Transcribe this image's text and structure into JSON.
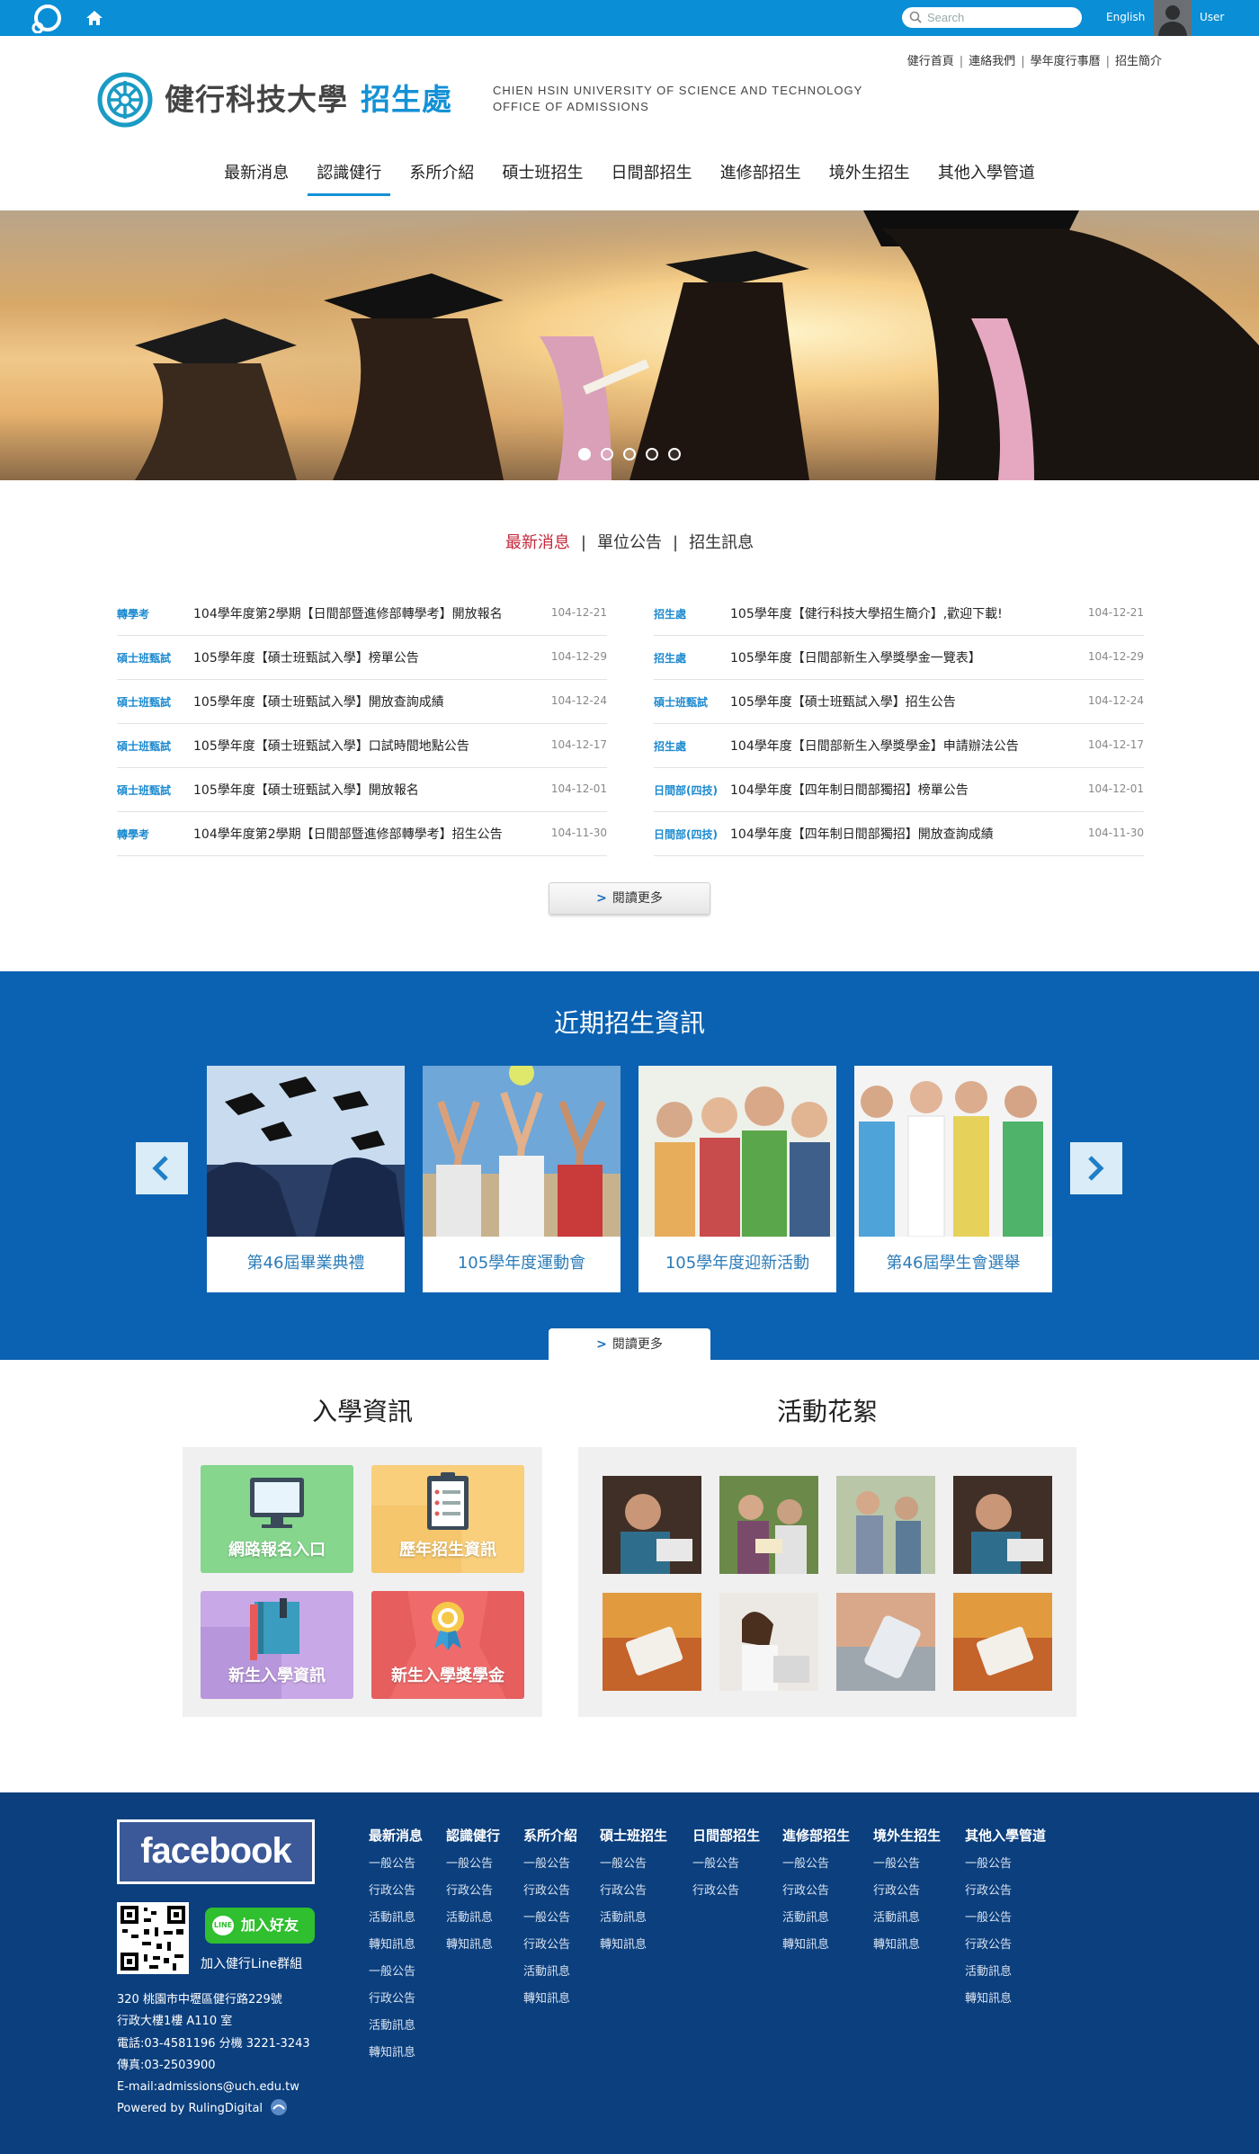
{
  "topbar": {
    "search_placeholder": "Search",
    "language": "English",
    "user": "User"
  },
  "header": {
    "utility_links": [
      "健行首頁",
      "連絡我們",
      "學年度行事曆",
      "招生簡介"
    ],
    "brand_zh": "健行科技大學",
    "brand_dept": "招生處",
    "brand_en_line1": "CHIEN HSIN UNIVERSITY OF SCIENCE AND TECHNOLOGY",
    "brand_en_line2": "OFFICE OF ADMISSIONS",
    "nav": [
      "最新消息",
      "認識健行",
      "系所介紹",
      "碩士班招生",
      "日間部招生",
      "進修部招生",
      "境外生招生",
      "其他入學管道"
    ],
    "nav_active": 1
  },
  "hero": {
    "slides": 5,
    "active_slide": 0
  },
  "news": {
    "tabs": [
      "最新消息",
      "單位公告",
      "招生訊息"
    ],
    "active_tab": 0,
    "left": [
      {
        "cat": "轉學考",
        "title": "104學年度第2學期【日間部暨進修部轉學考】開放報名",
        "date": "104-12-21"
      },
      {
        "cat": "碩士班甄試",
        "title": "105學年度【碩士班甄試入學】榜單公告",
        "date": "104-12-29"
      },
      {
        "cat": "碩士班甄試",
        "title": "105學年度【碩士班甄試入學】開放查詢成績",
        "date": "104-12-24"
      },
      {
        "cat": "碩士班甄試",
        "title": "105學年度【碩士班甄試入學】口試時間地點公告",
        "date": "104-12-17"
      },
      {
        "cat": "碩士班甄試",
        "title": "105學年度【碩士班甄試入學】開放報名",
        "date": "104-12-01"
      },
      {
        "cat": "轉學考",
        "title": "104學年度第2學期【日間部暨進修部轉學考】招生公告",
        "date": "104-11-30"
      }
    ],
    "right": [
      {
        "cat": "招生處",
        "title": "105學年度【健行科技大學招生簡介】,歡迎下載!",
        "date": "104-12-21"
      },
      {
        "cat": "招生處",
        "title": "105學年度【日間部新生入學獎學金一覽表】",
        "date": "104-12-29"
      },
      {
        "cat": "碩士班甄試",
        "title": "105學年度【碩士班甄試入學】招生公告",
        "date": "104-12-24"
      },
      {
        "cat": "招生處",
        "title": "104學年度【日間部新生入學獎學金】申請辦法公告",
        "date": "104-12-17"
      },
      {
        "cat": "日間部(四技)",
        "title": "104學年度【四年制日間部獨招】榜單公告",
        "date": "104-12-01"
      },
      {
        "cat": "日間部(四技)",
        "title": "104學年度【四年制日間部獨招】開放查詢成績",
        "date": "104-11-30"
      }
    ],
    "more_label": "閱讀更多"
  },
  "recent": {
    "title": "近期招生資訊",
    "cards": [
      "第46屆畢業典禮",
      "105學年度運動會",
      "105學年度迎新活動",
      "第46屆學生會選舉"
    ],
    "more_label": "閱讀更多"
  },
  "admission_info": {
    "title": "入學資訊",
    "tiles": [
      {
        "label": "網路報名入口",
        "color": "#86d68e"
      },
      {
        "label": "歷年招生資訊",
        "color": "#f9cf7c"
      },
      {
        "label": "新生入學資訊",
        "color": "#c8a8e6"
      },
      {
        "label": "新生入學獎學金",
        "color": "#ef6b6b"
      }
    ]
  },
  "gallery": {
    "title": "活動花絮"
  },
  "footer": {
    "facebook": "facebook",
    "line_button": "加入好友",
    "line_icon": "LINE",
    "line_caption": "加入健行Line群組",
    "address": [
      "320 桃園市中壢區健行路229號",
      "行政大樓1樓 A110 室",
      "電話:03-4581196 分機 3221-3243",
      "傳真:03-2503900",
      "E-mail:admissions@uch.edu.tw",
      "Powered by RulingDigital"
    ],
    "columns": [
      {
        "heading": "最新消息",
        "links": [
          "一般公告",
          "行政公告",
          "活動訊息",
          "轉知訊息",
          "一般公告",
          "行政公告",
          "活動訊息",
          "轉知訊息"
        ]
      },
      {
        "heading": "認識健行",
        "links": [
          "一般公告",
          "行政公告",
          "活動訊息",
          "轉知訊息"
        ]
      },
      {
        "heading": "系所介紹",
        "links": [
          "一般公告",
          "行政公告",
          "一般公告",
          "行政公告",
          "活動訊息",
          "轉知訊息"
        ]
      },
      {
        "heading": "碩士班招生",
        "links": [
          "一般公告",
          "行政公告",
          "活動訊息",
          "轉知訊息"
        ]
      },
      {
        "heading": "日間部招生",
        "links": [
          "一般公告",
          "行政公告"
        ]
      },
      {
        "heading": "進修部招生",
        "links": [
          "一般公告",
          "行政公告",
          "活動訊息",
          "轉知訊息"
        ]
      },
      {
        "heading": "境外生招生",
        "links": [
          "一般公告",
          "行政公告",
          "活動訊息",
          "轉知訊息"
        ]
      },
      {
        "heading": "其他入學管道",
        "links": [
          "一般公告",
          "行政公告",
          "一般公告",
          "行政公告",
          "活動訊息",
          "轉知訊息"
        ]
      }
    ]
  }
}
